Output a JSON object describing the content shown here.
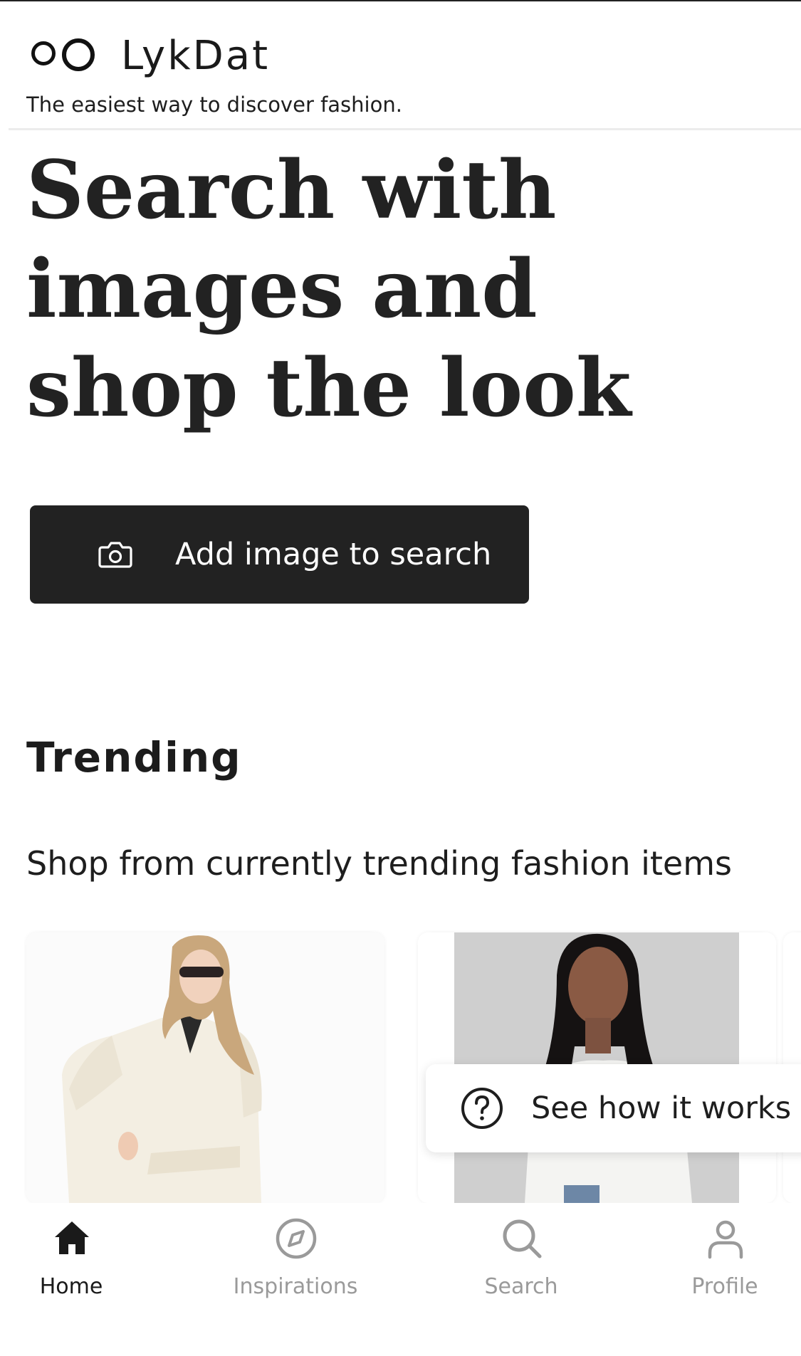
{
  "app": {
    "name": "LykDat",
    "tagline": "The easiest way to discover fashion."
  },
  "hero": {
    "title": "Search with images and shop the look",
    "cta_label": "Add image to search",
    "cta_icon": "camera-icon"
  },
  "trending": {
    "title": "Trending",
    "subtitle": "Shop from currently trending fashion items"
  },
  "help_fab": {
    "label": "See how it works",
    "icon": "question-circle-icon"
  },
  "bottom_nav": {
    "items": [
      {
        "label": "Home",
        "icon": "home-icon",
        "active": true
      },
      {
        "label": "Inspirations",
        "icon": "compass-icon",
        "active": false
      },
      {
        "label": "Search",
        "icon": "search-icon",
        "active": false
      },
      {
        "label": "Profile",
        "icon": "profile-icon",
        "active": false
      }
    ]
  },
  "colors": {
    "primary": "#222222",
    "active": "#1a1a1a",
    "inactive": "#9a9a9a",
    "background": "#ffffff"
  }
}
